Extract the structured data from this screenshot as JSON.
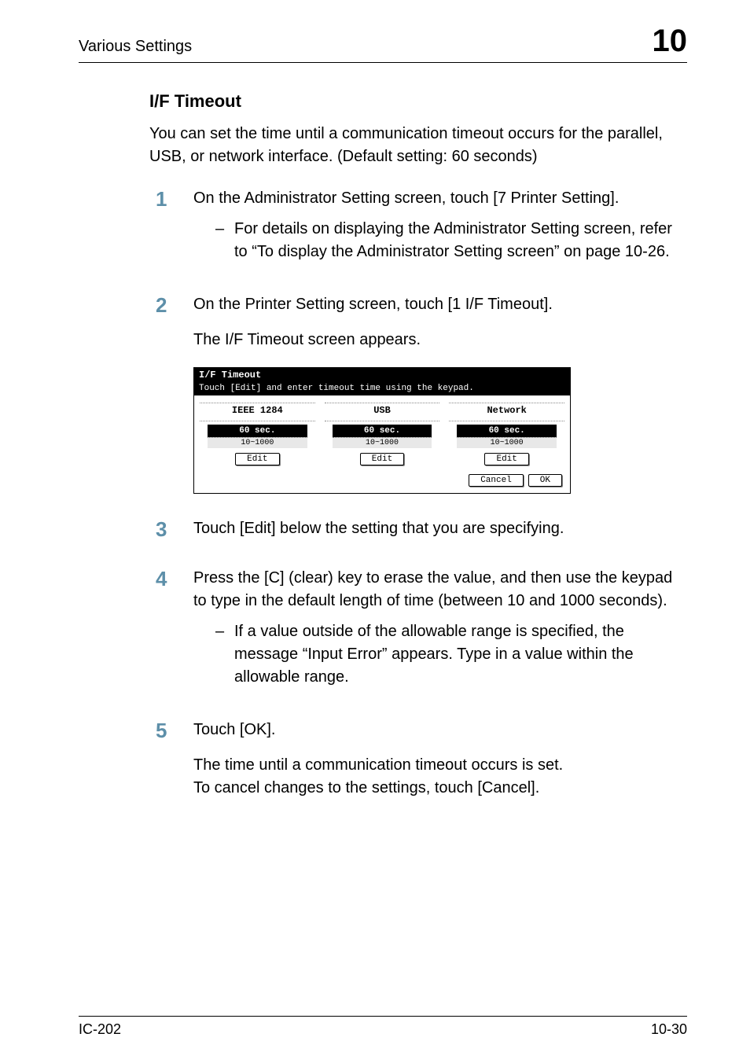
{
  "header": {
    "left": "Various Settings",
    "right": "10"
  },
  "section": {
    "title": "I/F Timeout",
    "intro": "You can set the time until a communication timeout occurs for the parallel, USB, or network interface. (Default setting: 60 seconds)"
  },
  "steps": [
    {
      "num": "1",
      "text": "On the Administrator Setting screen, touch [7 Printer Setting].",
      "subs": [
        "For details on displaying the Administrator Setting screen, refer to “To display the Administrator Setting screen” on page 10-26."
      ]
    },
    {
      "num": "2",
      "text": "On the Printer Setting screen, touch [1 I/F Timeout].",
      "after": "The I/F Timeout screen appears."
    },
    {
      "num": "3",
      "text": "Touch [Edit] below the setting that you are specifying."
    },
    {
      "num": "4",
      "text": "Press the [C] (clear) key to erase the value, and then use the keypad to type in the default length of time (between 10 and 1000 seconds).",
      "subs": [
        "If a value outside of the allowable range is specified, the message “Input Error” appears. Type in a value within the allowable range."
      ]
    },
    {
      "num": "5",
      "text": "Touch [OK].",
      "after": "The time until a communication timeout occurs is set.\nTo cancel changes to the settings, touch [Cancel]."
    }
  ],
  "device": {
    "title": "I/F Timeout",
    "subtitle": "Touch [Edit] and enter timeout time using the keypad.",
    "cols": [
      {
        "label": "IEEE 1284",
        "value": "60 sec.",
        "range": "10~1000",
        "edit": "Edit"
      },
      {
        "label": "USB",
        "value": "60 sec.",
        "range": "10~1000",
        "edit": "Edit"
      },
      {
        "label": "Network",
        "value": "60 sec.",
        "range": "10~1000",
        "edit": "Edit"
      }
    ],
    "cancel": "Cancel",
    "ok": "OK"
  },
  "footer": {
    "left": "IC-202",
    "right": "10-30"
  }
}
